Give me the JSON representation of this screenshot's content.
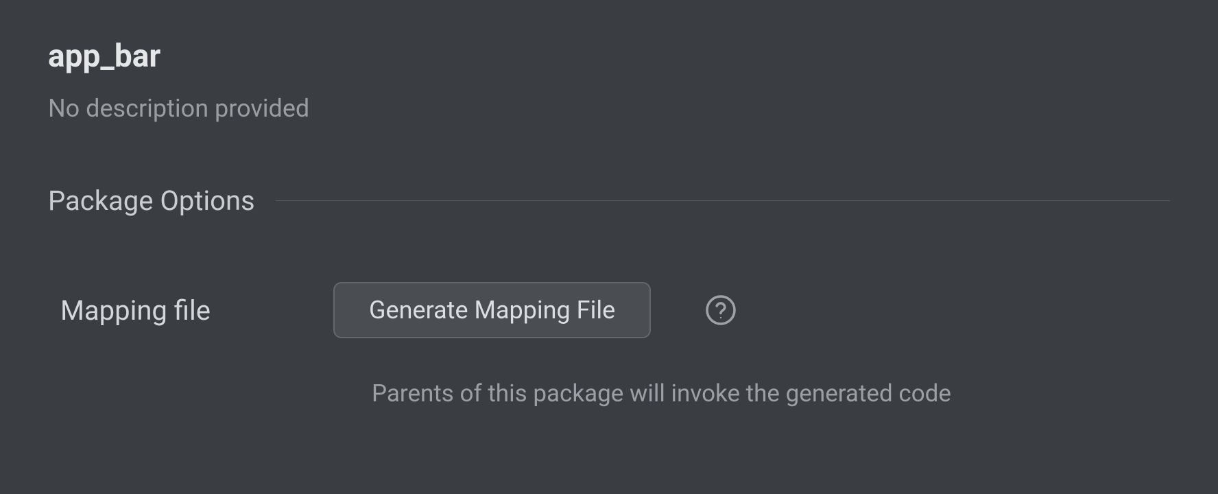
{
  "header": {
    "title": "app_bar",
    "description": "No description provided"
  },
  "section": {
    "label": "Package Options"
  },
  "options": {
    "mapping": {
      "label": "Mapping file",
      "button_label": "Generate Mapping File",
      "hint": "Parents of this package will invoke the generated code"
    }
  }
}
